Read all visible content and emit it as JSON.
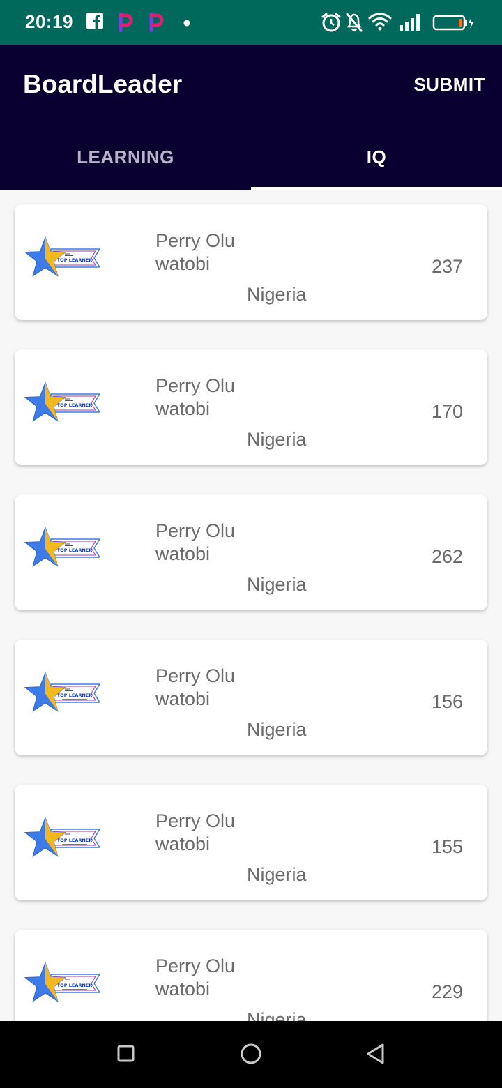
{
  "status_bar": {
    "time": "20:19",
    "icons": [
      "facebook-icon",
      "app-p-icon",
      "app-p-icon",
      "notification-dot-icon",
      "alarm-icon",
      "notifications-off-icon",
      "wifi-icon",
      "signal-icon",
      "battery-charging-icon"
    ]
  },
  "app_bar": {
    "title": "BoardLeader",
    "submit_label": "SUBMIT"
  },
  "tabs": [
    {
      "label": "LEARNING",
      "selected": false
    },
    {
      "label": "IQ",
      "selected": true
    }
  ],
  "entries": [
    {
      "badge_text": "TOP LEARNER",
      "name": "Perry Olu watobi",
      "country": "Nigeria",
      "score": "237"
    },
    {
      "badge_text": "TOP LEARNER",
      "name": "Perry Olu watobi",
      "country": "Nigeria",
      "score": "170"
    },
    {
      "badge_text": "TOP LEARNER",
      "name": "Perry Olu watobi",
      "country": "Nigeria",
      "score": "262"
    },
    {
      "badge_text": "TOP LEARNER",
      "name": "Perry Olu watobi",
      "country": "Nigeria",
      "score": "156"
    },
    {
      "badge_text": "TOP LEARNER",
      "name": "Perry Olu watobi",
      "country": "Nigeria",
      "score": "155"
    },
    {
      "badge_text": "TOP LEARNER",
      "name": "Perry Olu watobi",
      "country": "Nigeria",
      "score": "229"
    }
  ],
  "nav_bar": {
    "buttons": [
      "recents-square-icon",
      "home-circle-icon",
      "back-triangle-icon"
    ]
  },
  "colors": {
    "status_bar": "#00695c",
    "app_bar": "#0a0030",
    "star": "#3d7be8",
    "star_accent": "#f3b81f"
  }
}
